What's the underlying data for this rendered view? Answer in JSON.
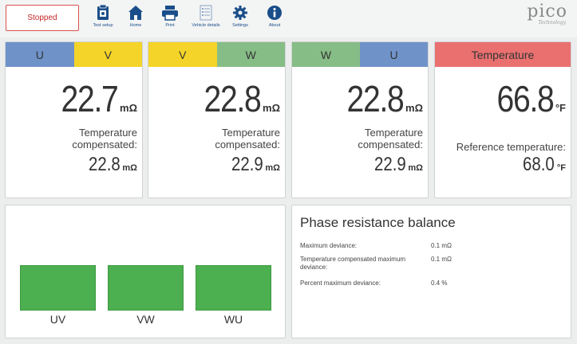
{
  "toolbar": {
    "status_label": "Stopped",
    "items": [
      {
        "label": "Test setup",
        "icon": "clipboard-icon"
      },
      {
        "label": "Home",
        "icon": "home-icon"
      },
      {
        "label": "Print",
        "icon": "printer-icon"
      },
      {
        "label": "Vehicle details",
        "icon": "checklist-icon"
      },
      {
        "label": "Settings",
        "icon": "gear-icon"
      },
      {
        "label": "About",
        "icon": "info-icon"
      }
    ],
    "logo_text": "pico",
    "logo_sub": "Technology"
  },
  "colors": {
    "phase_u": "#6f93c9",
    "phase_v": "#f4d428",
    "phase_w": "#86bd86",
    "temperature": "#ea7070",
    "bar_green": "#4caf50",
    "stopped_red": "#d9534f",
    "icon_blue": "#1a4e8a"
  },
  "cards": [
    {
      "phase_a": "U",
      "phase_b": "V",
      "value": "22.7",
      "unit": "mΩ",
      "comp_label": "Temperature compensated:",
      "comp_value": "22.8",
      "comp_unit": "mΩ"
    },
    {
      "phase_a": "V",
      "phase_b": "W",
      "value": "22.8",
      "unit": "mΩ",
      "comp_label": "Temperature compensated:",
      "comp_value": "22.9",
      "comp_unit": "mΩ"
    },
    {
      "phase_a": "W",
      "phase_b": "U",
      "value": "22.8",
      "unit": "mΩ",
      "comp_label": "Temperature compensated:",
      "comp_value": "22.9",
      "comp_unit": "mΩ"
    }
  ],
  "temperature": {
    "title": "Temperature",
    "value": "66.8",
    "unit": "°F",
    "ref_label": "Reference temperature:",
    "ref_value": "68.0",
    "ref_unit": "°F"
  },
  "bars": {
    "labels": [
      "UV",
      "VW",
      "WU"
    ]
  },
  "balance": {
    "title": "Phase resistance balance",
    "rows": [
      {
        "label": "Maximum deviance:",
        "value": "0.1 mΩ"
      },
      {
        "label": "Temperature compensated maximum deviance:",
        "value": "0.1 mΩ"
      },
      {
        "label": "Percent maximum deviance:",
        "value": "0.4 %"
      }
    ]
  }
}
